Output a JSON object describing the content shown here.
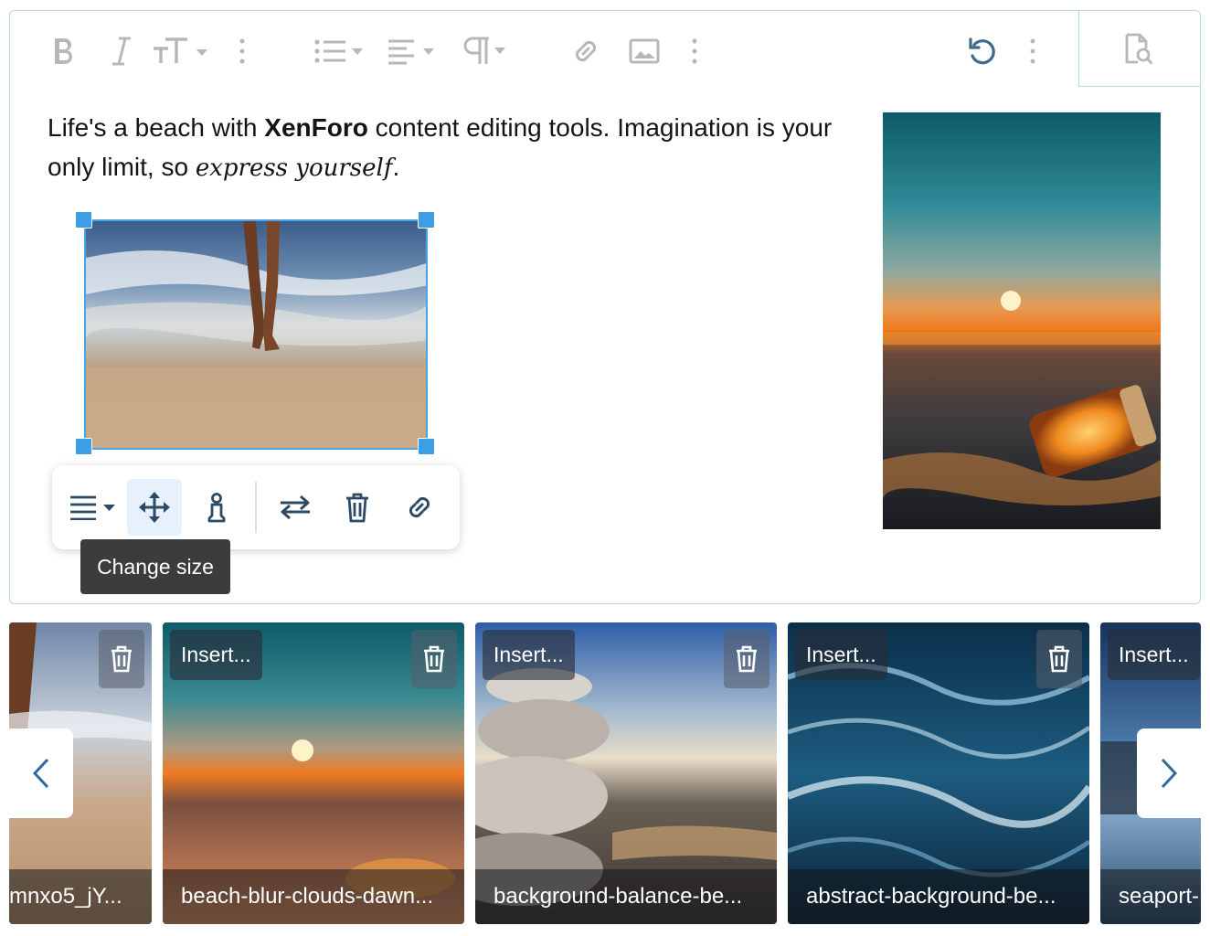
{
  "toolbar": {
    "icons": [
      "bold-icon",
      "italic-icon",
      "text-size-icon",
      "more-icon",
      "list-icon",
      "align-icon",
      "paragraph-icon",
      "link-icon",
      "image-icon",
      "more-icon",
      "undo-icon",
      "more-icon",
      "preview-icon"
    ]
  },
  "content": {
    "before_bold": "Life's a beach with ",
    "bold": "XenForo",
    "after_bold": " content editing tools. Imagination is your only limit, so ",
    "italic": "express yourself",
    "end": "."
  },
  "image_popup": {
    "buttons": [
      "align-icon",
      "change-size-icon",
      "alt-text-icon",
      "replace-icon",
      "delete-icon",
      "link-icon"
    ],
    "tooltip": "Change size"
  },
  "gallery": {
    "tiles": [
      {
        "insert": "",
        "caption": "mnxo5_jY..."
      },
      {
        "insert": "Insert...",
        "caption": "beach-blur-clouds-dawn..."
      },
      {
        "insert": "Insert...",
        "caption": "background-balance-be..."
      },
      {
        "insert": "Insert...",
        "caption": "abstract-background-be..."
      },
      {
        "insert": "Insert...",
        "caption": "seaport-"
      }
    ]
  },
  "colors": {
    "accent": "#3d9ee5",
    "border": "#b8d6e6",
    "icon_inactive": "#b4b8bd",
    "icon_active": "#2c4a66"
  }
}
